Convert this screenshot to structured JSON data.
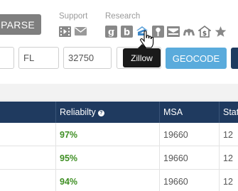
{
  "toolbar": {
    "parse_label": "PARSE",
    "support_label": "Support",
    "research_label": "Research",
    "support_icons": [
      "video-icon",
      "mail-icon"
    ],
    "research_icons": [
      "google-icon",
      "bing-icon",
      "zillow-icon",
      "pin-icon",
      "envelope-icon",
      "m-icon",
      "dollar-house-icon",
      "star-icon"
    ]
  },
  "address": {
    "state_value": "FL",
    "zip_value": "32750"
  },
  "geocode_label": "GEOCODE",
  "tooltip_text": "Zillow",
  "table": {
    "headers": {
      "reliability": "Reliabilty",
      "msa": "MSA",
      "stat": "Stat"
    },
    "help_glyph": "?",
    "rows": [
      {
        "reliability": "97%",
        "msa": "19660",
        "stat": "12"
      },
      {
        "reliability": "95%",
        "msa": "19660",
        "stat": "12"
      },
      {
        "reliability": "94%",
        "msa": "19660",
        "stat": "12"
      }
    ]
  },
  "colors": {
    "parse_button": "#7f7f7f",
    "geocode_button": "#5aabdc",
    "table_header": "#1f3a5f",
    "reliability_text": "#3f8f24",
    "tooltip_bg": "#1a1a1a"
  }
}
